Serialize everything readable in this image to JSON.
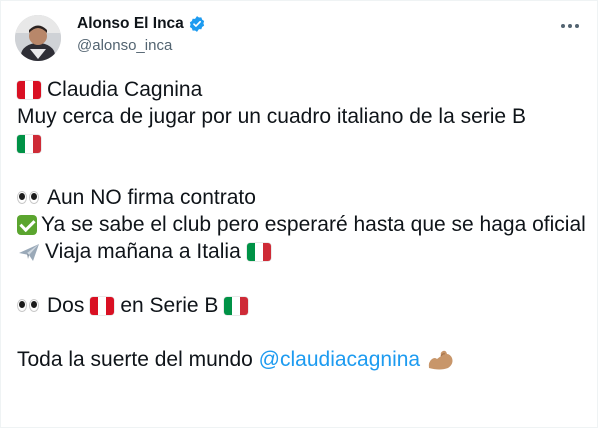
{
  "author": {
    "display_name": "Alonso El Inca",
    "handle": "@alonso_inca",
    "verified_icon": "verified-badge-icon"
  },
  "tweet": {
    "line1": "Claudia Cagnina",
    "line2": "Muy cerca de jugar por un cuadro italiano de la serie B",
    "line3": "Aun NO firma contrato",
    "line4": "Ya se sabe el club pero esperaré hasta que se haga oficial",
    "line5": "Viaja mañana a Italia",
    "line6a": "Dos",
    "line6b": "en Serie B",
    "line7": "Toda la suerte del mundo",
    "mention": "@claudiacagnina"
  },
  "icons": {
    "peru_flag": "peru-flag-icon",
    "italy_flag": "italy-flag-icon",
    "eyes": "eyes-icon",
    "check": "check-mark-icon",
    "airplane": "airplane-icon",
    "flexed_biceps": "flexed-biceps-icon",
    "more": "more-options-icon"
  },
  "colors": {
    "link": "#1d9bf0",
    "secondary_text": "#536471",
    "peru_red": "#d91023",
    "italy_green": "#009246",
    "italy_red": "#ce2b37"
  }
}
